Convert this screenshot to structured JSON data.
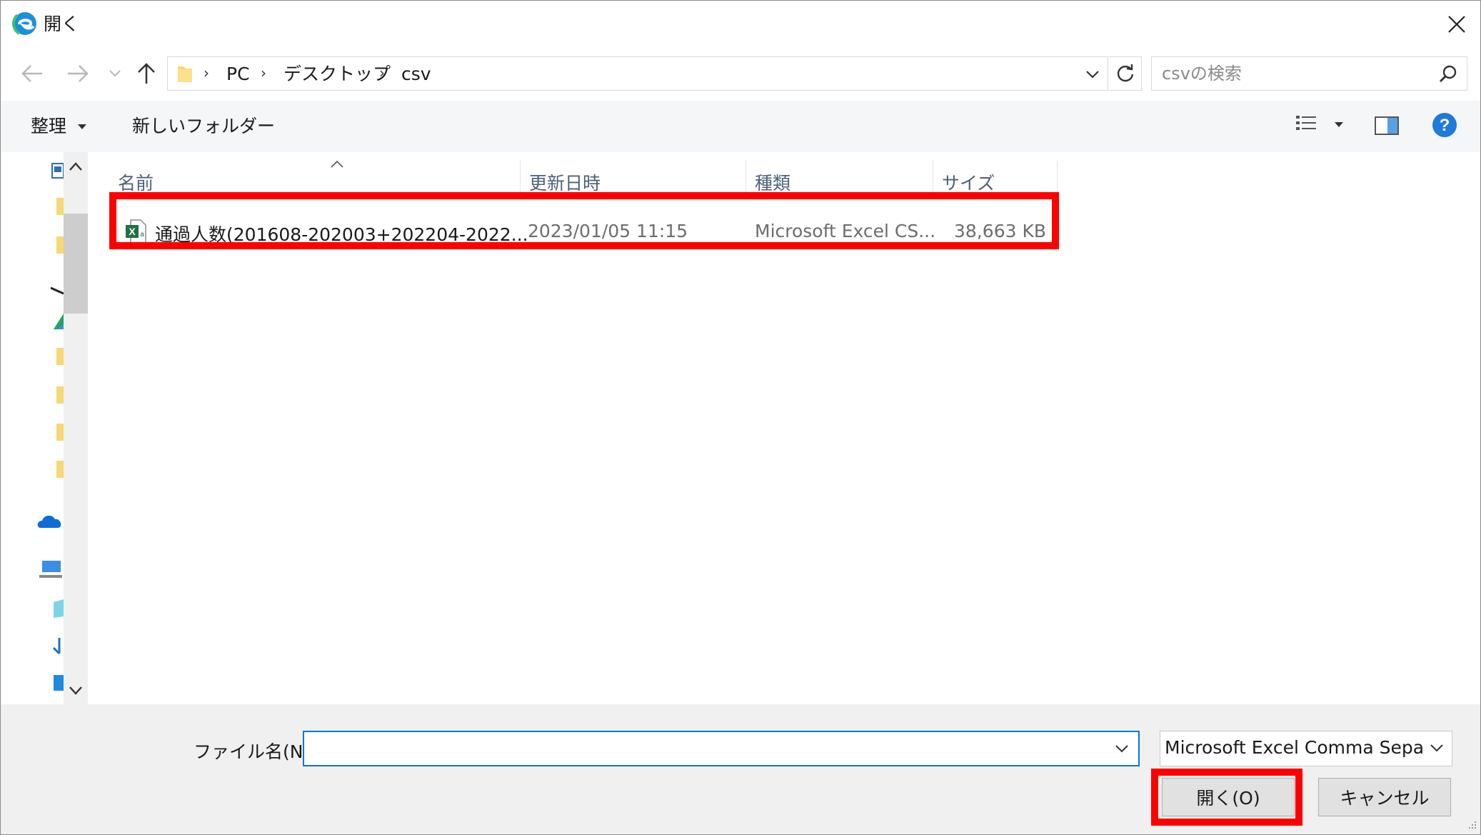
{
  "window": {
    "title": "開く",
    "close_icon": "close-icon"
  },
  "address": {
    "breadcrumbs": [
      "PC",
      "デスクトップ",
      "csv"
    ]
  },
  "search": {
    "placeholder": "csvの検索"
  },
  "toolbar": {
    "organize_label": "整理",
    "new_folder_label": "新しいフォルダー"
  },
  "columns": {
    "name": "名前",
    "modified": "更新日時",
    "type": "種類",
    "size": "サイズ"
  },
  "files": [
    {
      "name": "通過人数(201608-202003+202204-2022...",
      "modified": "2023/01/05 11:15",
      "type": "Microsoft Excel CS...",
      "size": "38,663 KB",
      "icon": "excel-csv-icon"
    }
  ],
  "footer": {
    "filename_label": "ファイル名(N):",
    "filename_value": "",
    "filetype_value": "Microsoft Excel Comma Separat",
    "open_label": "開く(O)",
    "cancel_label": "キャンセル"
  },
  "colors": {
    "highlight": "#ff0000",
    "accent": "#0078d7",
    "help": "#1f7ad9"
  }
}
